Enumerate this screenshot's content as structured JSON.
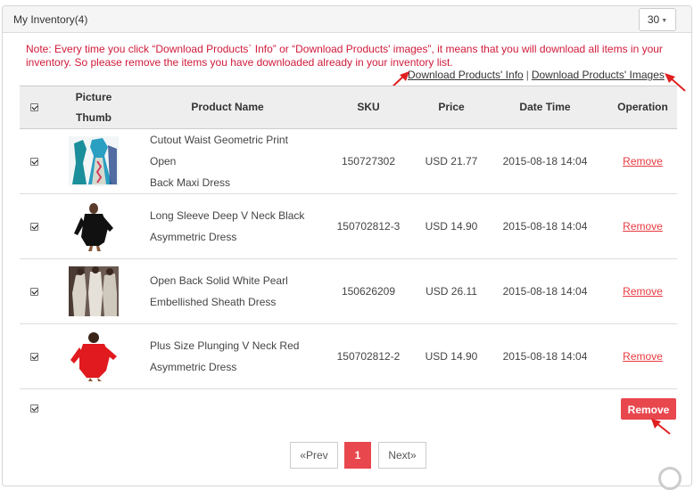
{
  "panel": {
    "title": "My Inventory(4)",
    "per_page": "30"
  },
  "note": "Note: Every time you click “Download Products` Info” or “Download Products' images”, it means that you will download all items in your inventory. So please remove the items you have downloaded already in your inventory list.",
  "downloads": {
    "info_label": "Download Products' Info",
    "separator": "|",
    "images_label": "Download Products' Images"
  },
  "table": {
    "headers": {
      "picture_line1": "Picture",
      "picture_line2": "Thumb",
      "name": "Product Name",
      "sku": "SKU",
      "price": "Price",
      "date": "Date Time",
      "operation": "Operation"
    },
    "rows": [
      {
        "name_line1": "Cutout Waist Geometric Print Open",
        "name_line2": "Back Maxi Dress",
        "sku": "150727302",
        "price": "USD 21.77",
        "date": "2015-08-18 14:04",
        "action": "Remove"
      },
      {
        "name_line1": "Long Sleeve Deep V Neck Black",
        "name_line2": "Asymmetric Dress",
        "sku": "150702812-3",
        "price": "USD 14.90",
        "date": "2015-08-18 14:04",
        "action": "Remove"
      },
      {
        "name_line1": "Open Back Solid White Pearl",
        "name_line2": "Embellished Sheath Dress",
        "sku": "150626209",
        "price": "USD 26.11",
        "date": "2015-08-18 14:04",
        "action": "Remove"
      },
      {
        "name_line1": "Plus Size Plunging V Neck Red",
        "name_line2": "Asymmetric Dress",
        "sku": "150702812-2",
        "price": "USD 14.90",
        "date": "2015-08-18 14:04",
        "action": "Remove"
      }
    ]
  },
  "bulk": {
    "remove_label": "Remove"
  },
  "pagination": {
    "prev": "«Prev",
    "current": "1",
    "next": "Next»"
  },
  "colors": {
    "accent": "#e8474e",
    "note": "#d01a3a",
    "arrow": "#e02020"
  }
}
